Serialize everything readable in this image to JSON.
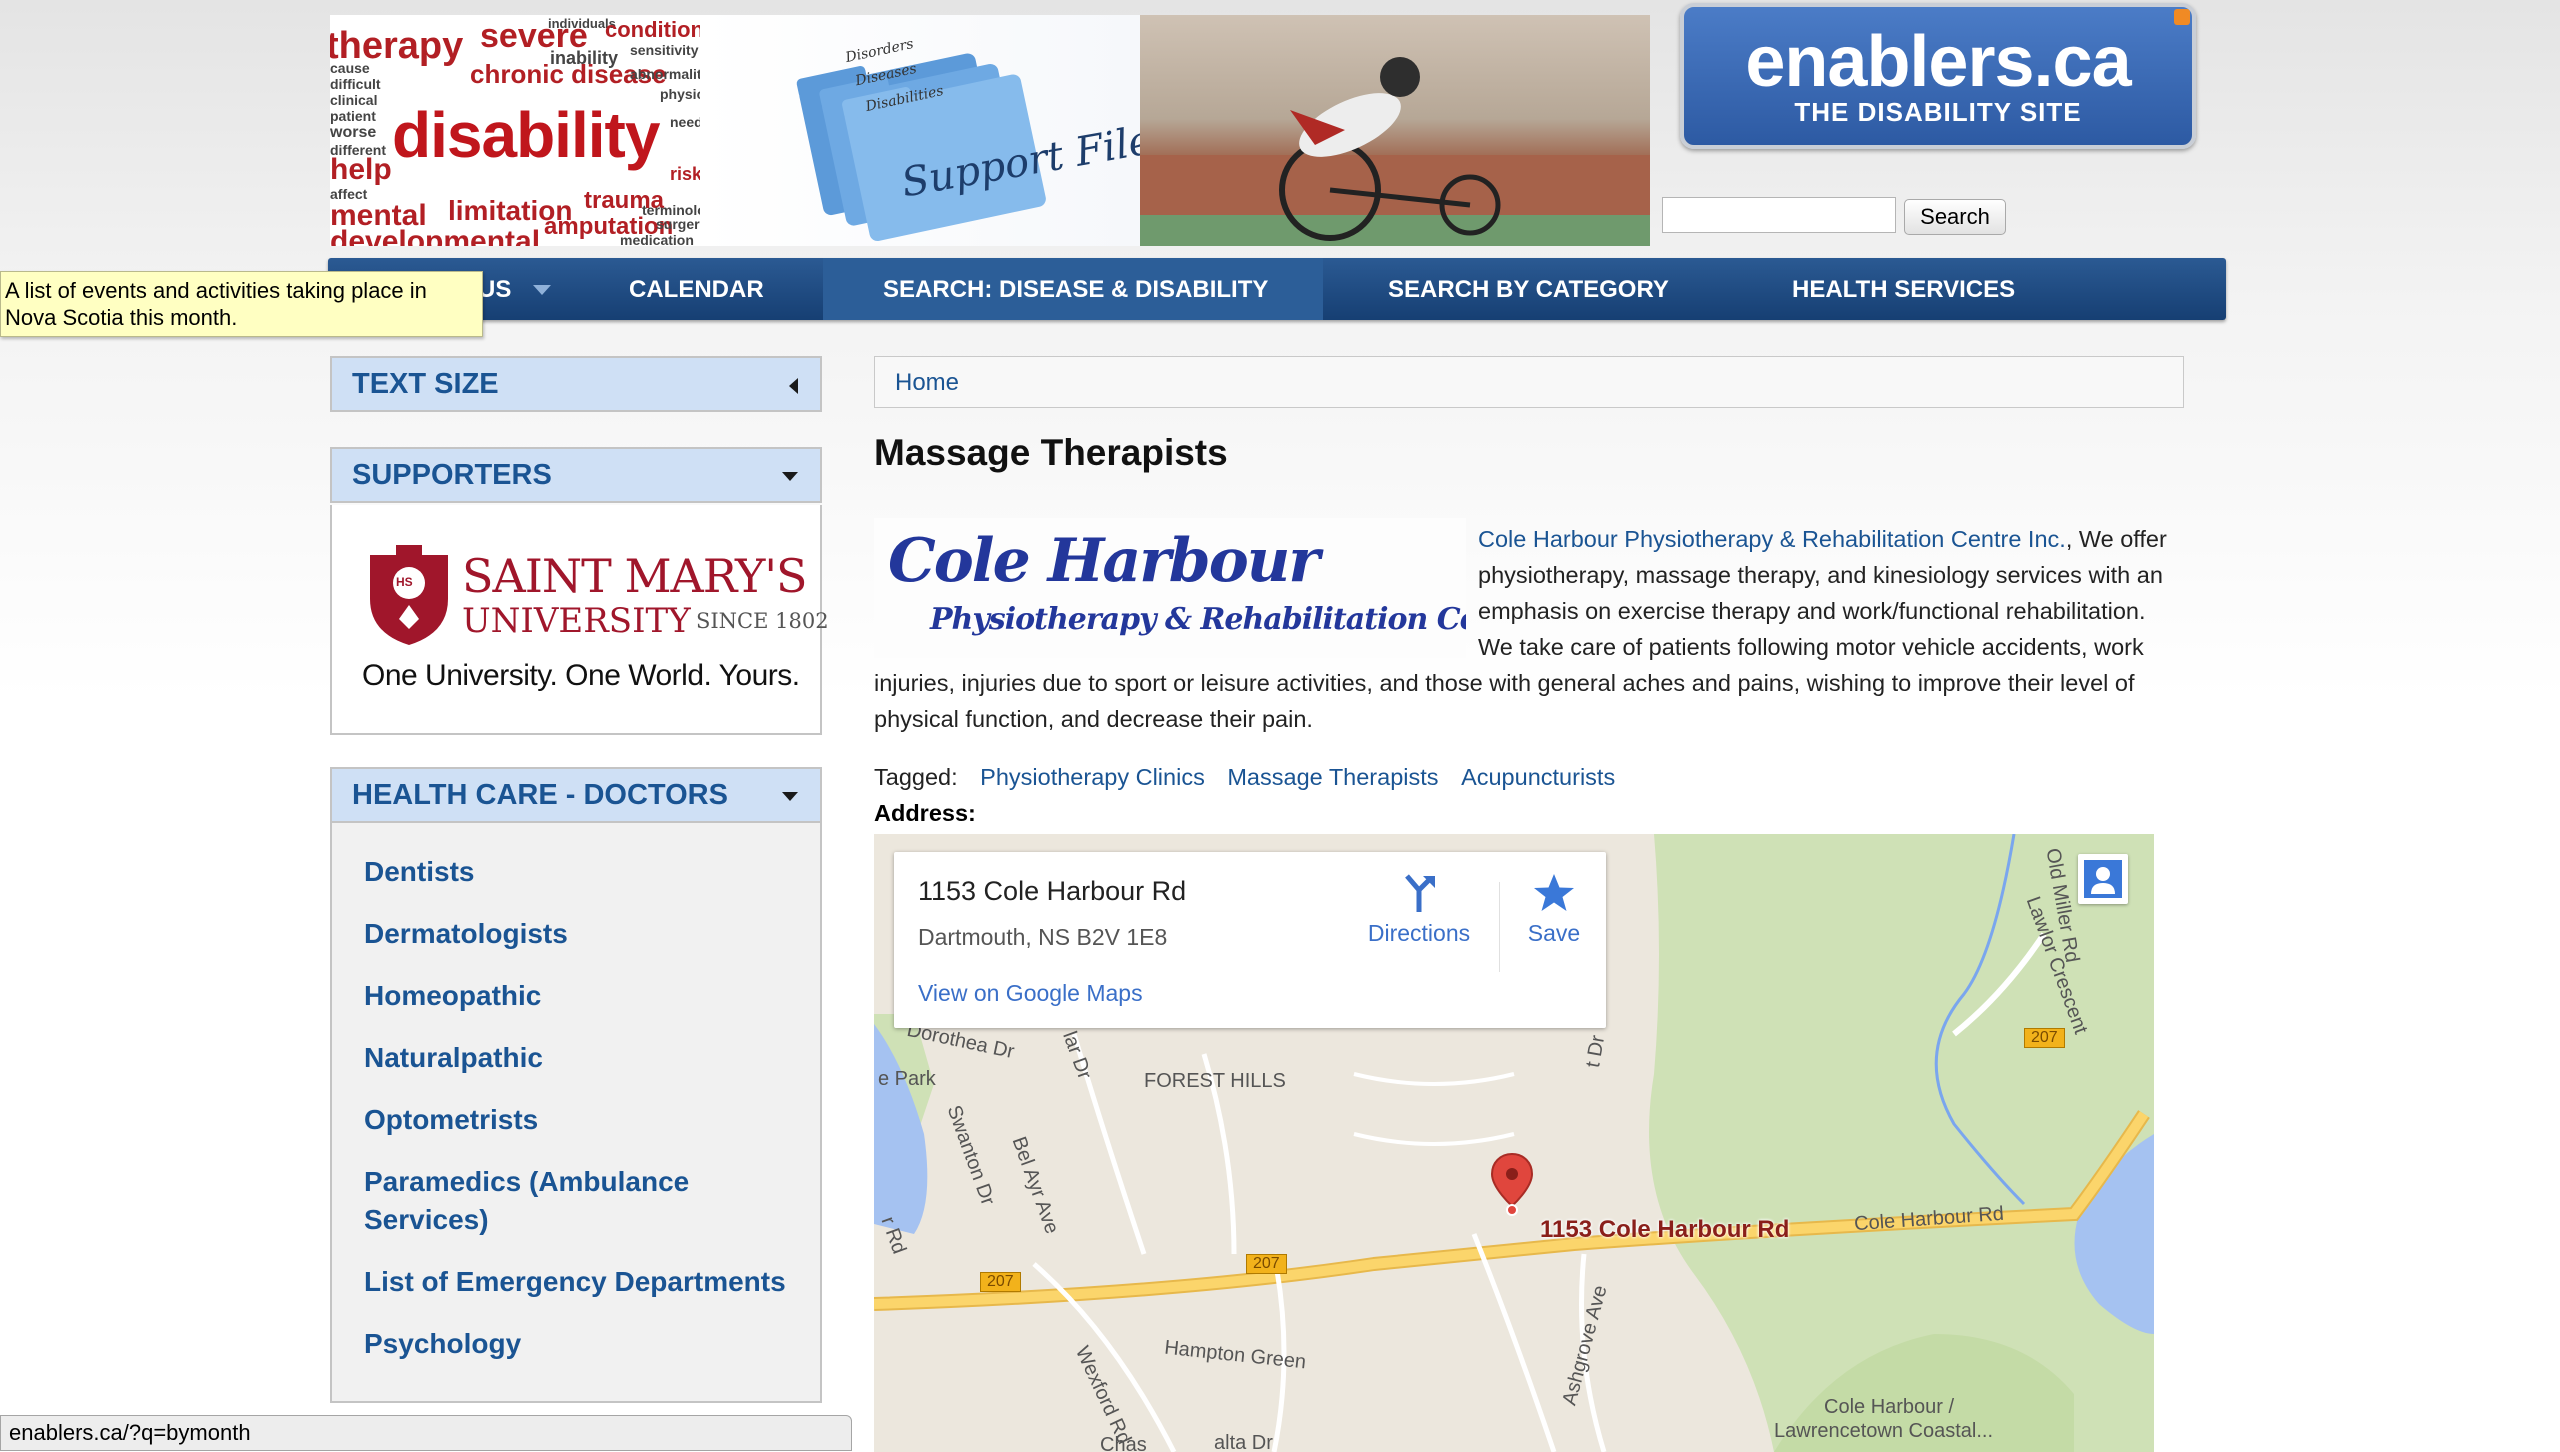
{
  "banner": {
    "wordcloud_words": [
      "therapy",
      "severe",
      "individuals",
      "conditions",
      "cause",
      "chronic disease",
      "inability",
      "sensitivity",
      "difficult",
      "clinical",
      "abnormality",
      "physical",
      "patient",
      "disability",
      "needs",
      "worse",
      "different",
      "help",
      "affect",
      "mental",
      "limitation",
      "trauma",
      "terminology",
      "amputation",
      "surgery",
      "risk",
      "developmental",
      "medication"
    ],
    "folder_tabs": [
      "Disorders",
      "Diseases",
      "Disabilities"
    ],
    "folder_label": "Support Files"
  },
  "logo": {
    "name": "enablers.ca",
    "tagline": "THE DISABILITY SITE"
  },
  "search": {
    "value": "",
    "button_label": "Search"
  },
  "nav": {
    "items": [
      "US",
      "CALENDAR",
      "SEARCH: DISEASE & DISABILITY",
      "SEARCH BY CATEGORY",
      "HEALTH SERVICES"
    ],
    "active_index": 2
  },
  "tooltip": {
    "text": "A list of events and activities taking place in Nova Scotia this month."
  },
  "sidebar": {
    "text_size": {
      "title": "TEXT SIZE"
    },
    "supporters": {
      "title": "SUPPORTERS",
      "ad": {
        "name_line1": "SAINT MARY'S",
        "name_line2": "UNIVERSITY",
        "since": "SINCE 1802",
        "slogan": "One University. One World. Yours.",
        "crest_text": "HS"
      }
    },
    "doctors": {
      "title": "HEALTH CARE - DOCTORS",
      "links": [
        "Dentists",
        "Dermatologists",
        "Homeopathic",
        "Naturalpathic",
        "Optometrists",
        "Paramedics (Ambulance Services)",
        "List of Emergency Departments",
        "Psychology"
      ]
    }
  },
  "breadcrumb": {
    "home": "Home"
  },
  "page": {
    "title": "Massage Therapists",
    "listing_logo": {
      "line1": "Cole Harbour",
      "line2": "Physiotherapy & Rehabilitation Centre Inc."
    },
    "business_link": "Cole Harbour Physiotherapy & Rehabilitation Centre Inc.",
    "description": ",  We offer physiotherapy, massage therapy, and kinesiology services with an emphasis on exercise therapy and work/functional rehabilitation.  We take care of patients following motor vehicle accidents, work injuries, injuries due to sport or leisure activities, and those with general aches and pains, wishing to improve their level of physical function, and decrease their pain.",
    "tagged_label": "Tagged:",
    "tags": [
      "Physiotherapy Clinics",
      "Massage Therapists",
      "Acupuncturists"
    ],
    "address_label": "Address:"
  },
  "map": {
    "card": {
      "address_line1": "1153 Cole Harbour Rd",
      "address_line2": "Dartmouth, NS B2V 1E8",
      "view_link": "View on Google Maps",
      "directions": "Directions",
      "save": "Save"
    },
    "marker_label": "1153 Cole Harbour Rd",
    "labels": {
      "forest_hills": "FOREST HILLS",
      "dorothea": "Dorothea Dr",
      "park": "e Park",
      "swanton": "Swanton Dr",
      "bel_ayr": "Bel Ayr Ave",
      "rd_left": "r Rd",
      "hampton": "Hampton Green",
      "wexford": "Wexford Rd",
      "ashgrove": "Ashgrove Ave",
      "cole_harbour_rd": "Cole Harbour Rd",
      "lawlor": "Lawlor Crescent",
      "old_miller": "Old Miller Rd",
      "lawrencetown_1": "Cole Harbour /",
      "lawrencetown_2": "Lawrencetown Coastal...",
      "chas": "Chas",
      "alta": "alta Dr",
      "lar_dr": "lar Dr",
      "t_dr": "t Dr",
      "route_207": "207"
    },
    "colors": {
      "water": "#a5c2f1",
      "park": "#cbdfb3",
      "road": "#fbd56b",
      "marker": "#e0463d"
    }
  },
  "status_bar": {
    "url": "enablers.ca/?q=bymonth"
  }
}
